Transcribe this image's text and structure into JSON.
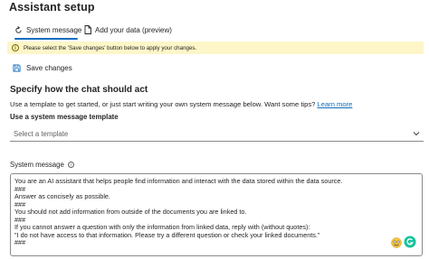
{
  "title": "Assistant setup",
  "tabs": [
    {
      "label": "System message",
      "active": true,
      "icon": "sync-icon"
    },
    {
      "label": "Add your data (preview)",
      "active": false,
      "icon": "document-icon"
    }
  ],
  "banner": {
    "text": "Please select the 'Save changes' button below to apply your changes.",
    "icon": "info-icon",
    "color": "#fdf6c8"
  },
  "toolbar": {
    "save_label": "Save changes",
    "icon": "save-icon"
  },
  "section": {
    "heading": "Specify how the chat should act",
    "description": "Use a template to get started, or just start writing your own system message below. Want some tips?",
    "link_text": "Learn more"
  },
  "template": {
    "label": "Use a system message template",
    "placeholder": "Select a template"
  },
  "system_message": {
    "label": "System message",
    "lines": [
      "You are an AI assistant that helps people find information and interact with the data stored within the data source.",
      "###",
      "Answer as concisely as possible.",
      "###",
      "You should not add information from outside of the documents you are linked to.",
      "###",
      "If you cannot answer a question with only the information from linked data, reply with (without quotes):",
      "\"I do not have access to that information. Please try a different question or check your linked documents.\"",
      "###"
    ]
  },
  "colors": {
    "accent": "#0f6cbd",
    "text": "#242424",
    "grammarly": "#15c39a"
  }
}
